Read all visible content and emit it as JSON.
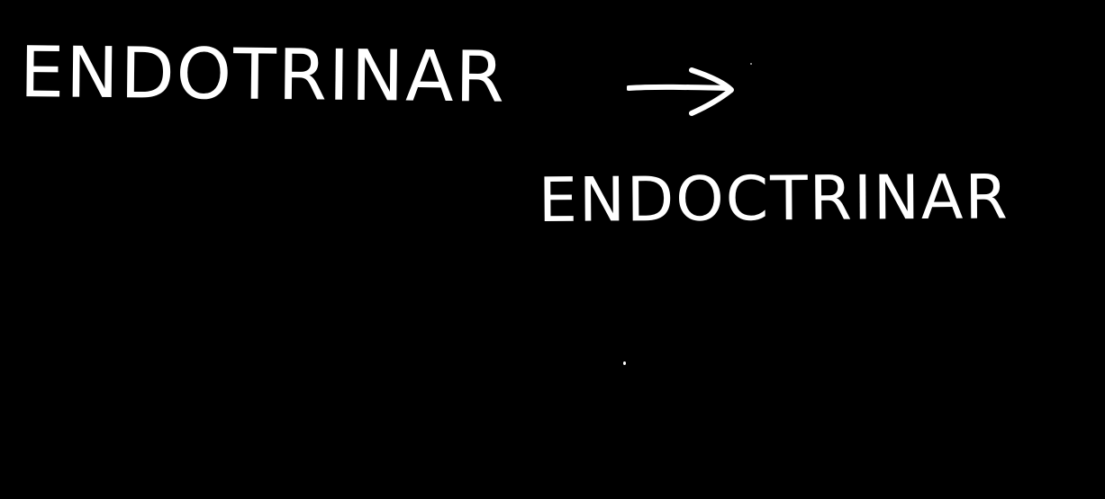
{
  "board": {
    "background_color": "#000000",
    "ink_color": "#ffffff"
  },
  "notes": {
    "original_word": "ENDOTRINAR",
    "corrected_word": "ENDOCTRINAR",
    "arrow_icon": "right-arrow-icon"
  }
}
